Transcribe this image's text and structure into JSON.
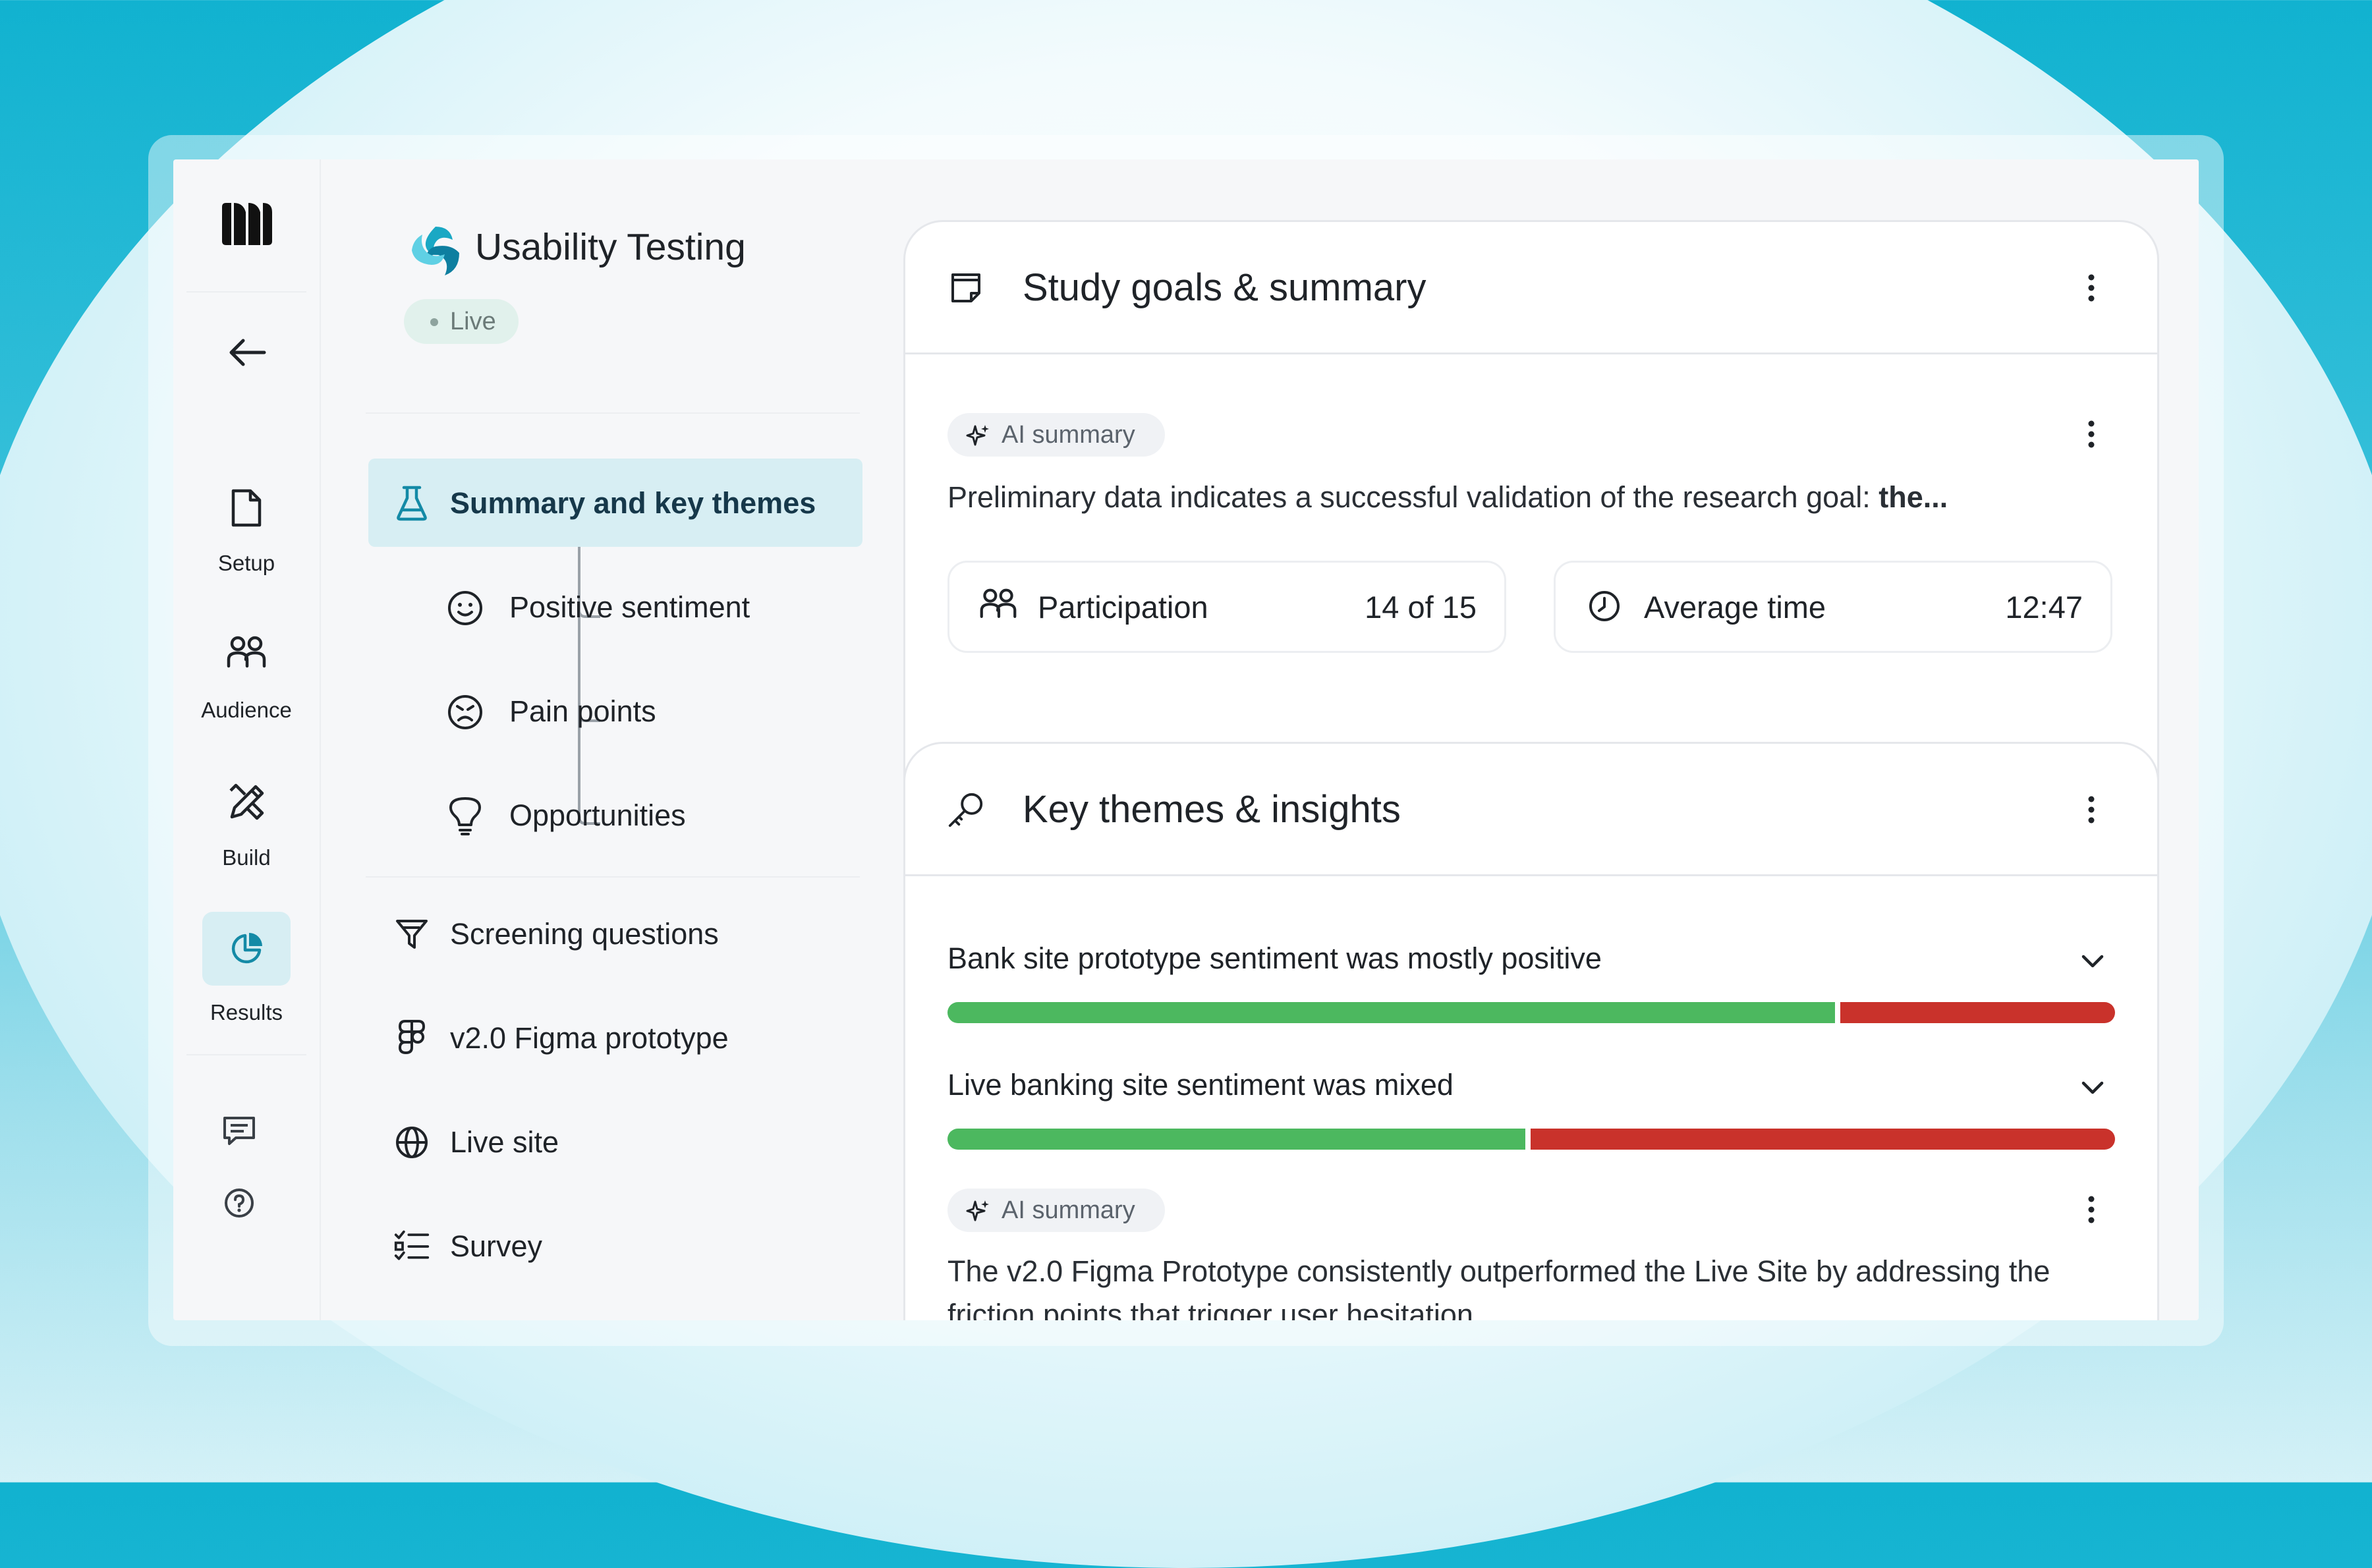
{
  "colors": {
    "accent": "#1aa8c4",
    "active_bg": "#d7eef3",
    "positive": "#4cb85f",
    "negative": "#c9322b",
    "live_pill_bg": "#e1f1ec"
  },
  "rail": {
    "logo": "brand-logo",
    "back_icon": "arrow-left-icon",
    "items": [
      {
        "label": "Setup",
        "icon": "document-icon"
      },
      {
        "label": "Audience",
        "icon": "people-icon"
      },
      {
        "label": "Build",
        "icon": "pencil-ruler-icon"
      },
      {
        "label": "Results",
        "icon": "pie-chart-icon",
        "active": true
      }
    ],
    "bottom_icons": [
      "chat-icon",
      "help-icon"
    ]
  },
  "project": {
    "title": "Usability Testing",
    "status": "Live"
  },
  "nav": {
    "active": {
      "label": "Summary and key themes",
      "icon": "flask-icon"
    },
    "sub_items": [
      {
        "label": "Positive sentiment",
        "icon": "smile-icon"
      },
      {
        "label": "Pain points",
        "icon": "frown-icon"
      },
      {
        "label": "Opportunities",
        "icon": "lightbulb-icon"
      }
    ],
    "items": [
      {
        "label": "Screening questions",
        "icon": "filter-icon"
      },
      {
        "label": "v2.0 Figma prototype",
        "icon": "figma-icon"
      },
      {
        "label": "Live site",
        "icon": "globe-icon"
      },
      {
        "label": "Survey",
        "icon": "checklist-icon"
      }
    ]
  },
  "study_card": {
    "title": "Study goals & summary",
    "icon": "notes-icon",
    "ai_label": "AI summary",
    "summary_text": "Preliminary data indicates a successful validation of the research goal: ",
    "summary_bold": "the...",
    "stats": [
      {
        "label": "Participation",
        "value": "14 of 15",
        "icon": "people-icon"
      },
      {
        "label": "Average time",
        "value": "12:47",
        "icon": "clock-icon"
      }
    ]
  },
  "themes_card": {
    "title": "Key themes & insights",
    "icon": "key-icon",
    "themes": [
      {
        "label": "Bank site prototype sentiment was mostly positive",
        "positive_fraction": 0.76
      },
      {
        "label": "Live banking site sentiment was mixed",
        "positive_fraction": 0.495
      }
    ],
    "ai_label": "AI summary",
    "insight_text": "The v2.0 Figma Prototype consistently outperformed the Live Site by addressing the friction points that trigger user hesitation."
  }
}
